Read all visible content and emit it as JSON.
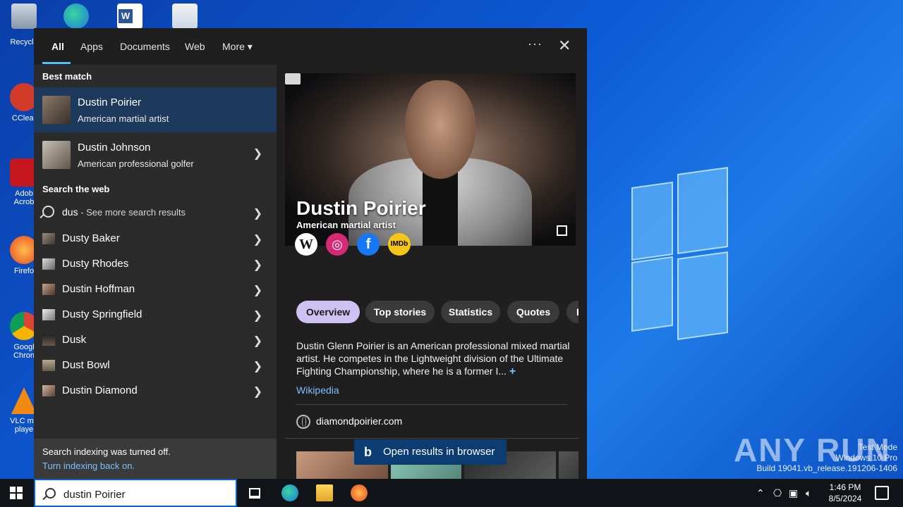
{
  "desktop": {
    "icons": [
      {
        "label": "Recycle",
        "color": "#9aa7b5"
      },
      {
        "label": "CClear",
        "color": "#d23b2a"
      },
      {
        "label": "Adob Acrob",
        "color": "#c5161d"
      },
      {
        "label": "Firefo",
        "color": "#ff7a18"
      },
      {
        "label": "Googl Chron",
        "color": "#2f9e44"
      },
      {
        "label": "VLC me playe",
        "color": "#f08a12"
      }
    ],
    "watermark": {
      "line1": "Test Mode",
      "line2": "Windows 10 Pro",
      "line3": "Build 19041.vb_release.191206-1406"
    },
    "brand": "ANY RUN"
  },
  "search_panel": {
    "tabs": [
      {
        "label": "All",
        "active": true
      },
      {
        "label": "Apps"
      },
      {
        "label": "Documents"
      },
      {
        "label": "Web"
      },
      {
        "label": "More ▾"
      }
    ],
    "more_options": "···",
    "close": "✕",
    "best_match_title": "Best match",
    "best_match": [
      {
        "name": "Dustin Poirier",
        "subtitle": "American martial artist",
        "selected": true
      },
      {
        "name": "Dustin Johnson",
        "subtitle": "American professional golfer",
        "selected": false
      }
    ],
    "web_title": "Search the web",
    "web_query": {
      "query": "dus",
      "suffix": " - See more search results"
    },
    "web_results": [
      "Dusty Baker",
      "Dusty Rhodes",
      "Dustin Hoffman",
      "Dusty Springfield",
      "Dusk",
      "Dust Bowl",
      "Dustin Diamond"
    ],
    "indexing": {
      "message": "Search indexing was turned off.",
      "link": "Turn indexing back on."
    },
    "preview": {
      "name": "Dustin Poirier",
      "subtitle": "American martial artist",
      "socials": [
        {
          "name": "W",
          "bg": "#ffffff",
          "fg": "#111111"
        },
        {
          "name": "◎",
          "bg": "#d62976",
          "fg": "#ffffff"
        },
        {
          "name": "f",
          "bg": "#1877f2",
          "fg": "#ffffff"
        },
        {
          "name": "IMDb",
          "bg": "#f5c518",
          "fg": "#000000"
        }
      ],
      "chips": [
        {
          "label": "Overview",
          "active": true
        },
        {
          "label": "Top stories"
        },
        {
          "label": "Statistics"
        },
        {
          "label": "Quotes"
        },
        {
          "label": "I"
        }
      ],
      "description": "Dustin Glenn Poirier is an American professional mixed martial artist. He competes in the Lightweight division of the Ultimate Fighting Championship, where he is a former I...",
      "expand": "+",
      "source": "Wikipedia",
      "website": "diamondpoirier.com"
    },
    "open_browser": "Open results in browser"
  },
  "taskbar": {
    "search_value": "dustin Poirier",
    "time": "1:46 PM",
    "date": "8/5/2024"
  }
}
